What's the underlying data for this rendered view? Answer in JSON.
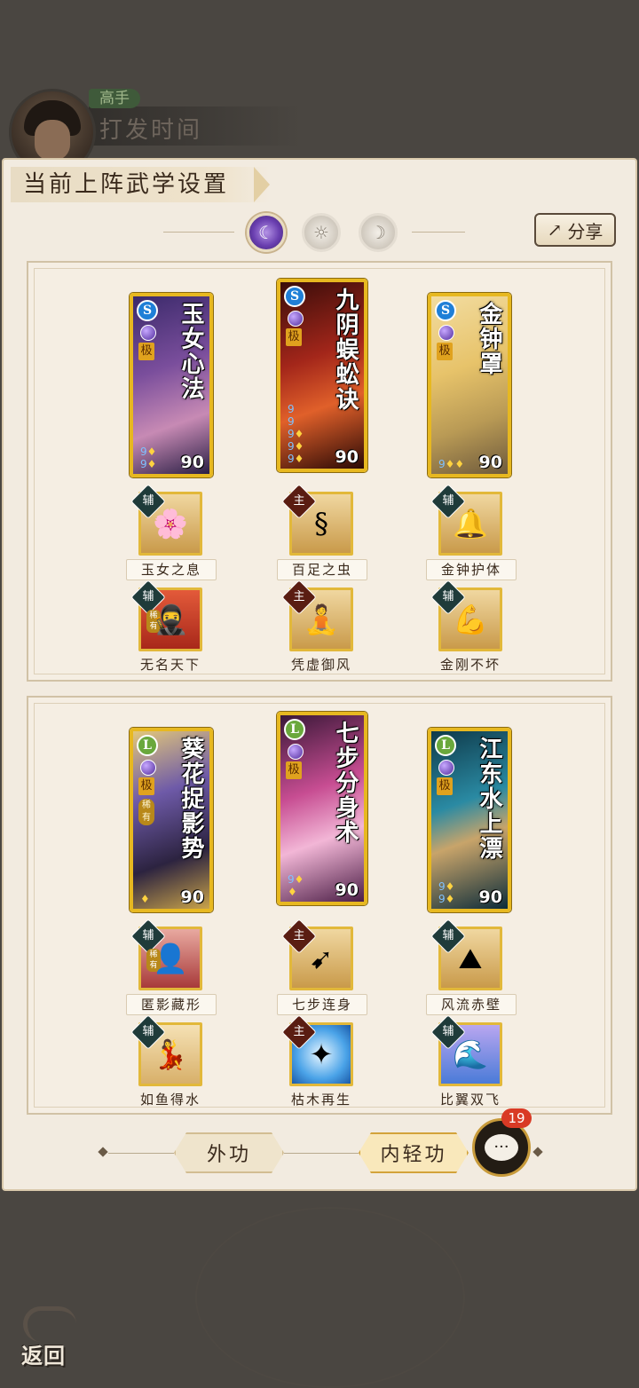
{
  "header": {
    "rank": "高手",
    "player_name": "打发时间"
  },
  "panel": {
    "title": "当前上阵武学设置",
    "share_label": "分享",
    "tabs": [
      {
        "icon": "purple-moon-icon",
        "active": true
      },
      {
        "icon": "sun-icon",
        "active": false
      },
      {
        "icon": "crescent-icon",
        "active": false
      }
    ]
  },
  "colors": {
    "card_border": "#e7b820",
    "accent_purple": "#6a3fb0",
    "badge_red": "#d93a25",
    "panel_bg": "#f2ebe0"
  },
  "group1": {
    "cards": [
      {
        "title": "玉女心法",
        "element": "S",
        "grade": "极",
        "level": "90",
        "bg": "linear-gradient(160deg,#3b2a6b,#7a4e9c 40%,#c78ab4 70%,#2a1f45)"
      },
      {
        "title": "九阴蜈蚣诀",
        "element": "S",
        "grade": "极",
        "level": "90",
        "bg": "linear-gradient(160deg,#3a0d0a,#a3261a 40%,#e0602a 65%,#2a0905)"
      },
      {
        "title": "金钟罩",
        "element": "S",
        "grade": "极",
        "level": "90",
        "bg": "linear-gradient(160deg,#f2dca0,#e7c36a 40%,#b99a55 70%,#6e5a3c)"
      }
    ],
    "skills_row1": [
      {
        "label": "玉女之息",
        "type": "辅",
        "icon": "plum-tree-icon"
      },
      {
        "label": "百足之虫",
        "type": "主",
        "icon": "centipede-icon"
      },
      {
        "label": "金钟护体",
        "type": "辅",
        "icon": "bell-shield-icon"
      }
    ],
    "skills_row2": [
      {
        "label": "无名天下",
        "type": "辅",
        "rare": "稀有",
        "icon": "swordsman-icon"
      },
      {
        "label": "凭虚御风",
        "type": "主",
        "icon": "wind-figure-icon"
      },
      {
        "label": "金刚不坏",
        "type": "辅",
        "icon": "strongman-icon"
      }
    ]
  },
  "group2": {
    "cards": [
      {
        "title": "葵花捉影势",
        "element": "L",
        "grade": "极",
        "rare": "稀有",
        "level": "90",
        "bg": "linear-gradient(160deg,#e2c77a,#6e5aa8 35%,#2c2340 70%,#c9a34a)"
      },
      {
        "title": "七步分身术",
        "element": "L",
        "grade": "极",
        "level": "90",
        "bg": "linear-gradient(160deg,#3a1838,#c74d92 40%,#f2b6d6 65%,#4b1e46)"
      },
      {
        "title": "江东水上漂",
        "element": "L",
        "grade": "极",
        "level": "90",
        "bg": "linear-gradient(160deg,#0f3a4a,#2a8aa3 40%,#c8a46a 60%,#0c2c3a)"
      }
    ],
    "skills_row1": [
      {
        "label": "匿影藏形",
        "type": "辅",
        "rare": "稀有",
        "icon": "shadow-icon"
      },
      {
        "label": "七步连身",
        "type": "主",
        "icon": "dash-icon"
      },
      {
        "label": "风流赤壁",
        "type": "辅",
        "icon": "cliff-icon"
      }
    ],
    "skills_row2": [
      {
        "label": "如鱼得水",
        "type": "辅",
        "icon": "dancer-icon"
      },
      {
        "label": "枯木再生",
        "type": "主",
        "icon": "light-burst-icon"
      },
      {
        "label": "比翼双飞",
        "type": "辅",
        "icon": "wave-icon"
      }
    ]
  },
  "bottom": {
    "outer_label": "外功",
    "inner_label": "内轻功",
    "chat_badge": "19"
  },
  "back_label": "返回"
}
